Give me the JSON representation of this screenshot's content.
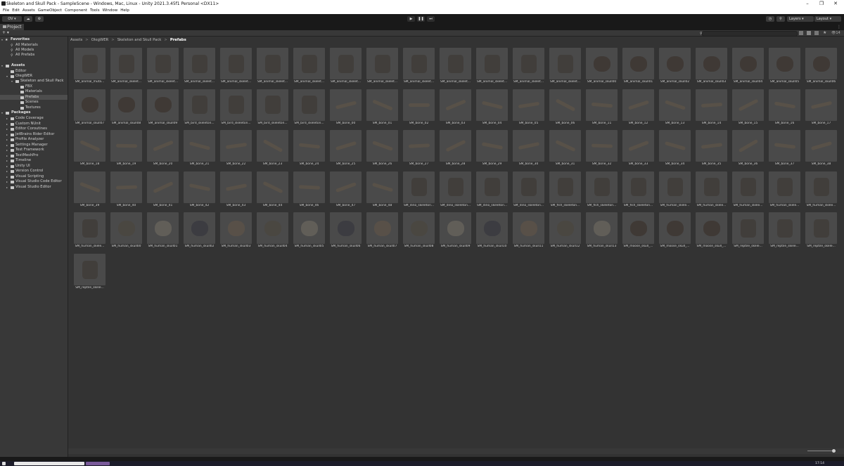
{
  "window": {
    "title": "Skeleton and Skull Pack - SampleScene - Windows, Mac, Linux - Unity 2021.3.45f1 Personal <DX11>"
  },
  "menu": [
    "File",
    "Edit",
    "Assets",
    "GameObject",
    "Component",
    "Tools",
    "Window",
    "Help"
  ],
  "toolbar": {
    "account": "OV",
    "layers": "Layers",
    "layout": "Layout"
  },
  "project_tab": "Project",
  "icon_count": "14",
  "sidebar": {
    "favorites_label": "Favorites",
    "favorites": [
      "All Materials",
      "All Models",
      "All Prefabs"
    ],
    "assets_label": "Assets",
    "assets": [
      "Editor",
      "OlegWER",
      "Skeleton and Skull Pack",
      "FBX",
      "Materials",
      "Prefabs",
      "Scenes",
      "Textures"
    ],
    "packages_label": "Packages",
    "packages": [
      "Code Coverage",
      "Custom NUnit",
      "Editor Coroutines",
      "JetBrains Rider Editor",
      "Profile Analyzer",
      "Settings Manager",
      "Test Framework",
      "TextMeshPro",
      "Timeline",
      "Unity UI",
      "Version Control",
      "Visual Scripting",
      "Visual Studio Code Editor",
      "Visual Studio Editor"
    ]
  },
  "breadcrumb": [
    "Assets",
    "OlegWER",
    "Skeleton and Skull Pack",
    "Prefabs"
  ],
  "assets": [
    "SM_animal_muta...",
    "SM_animal_skelet...",
    "SM_animal_skelet...",
    "SM_animal_skelet...",
    "SM_animal_skelet...",
    "SM_animal_skelet...",
    "SM_animal_skelet...",
    "SM_animal_skelet...",
    "SM_animal_skelet...",
    "SM_animal_skelet...",
    "SM_animal_skelet...",
    "SM_animal_skelet...",
    "SM_animal_skelet...",
    "SM_animal_skelet...",
    "SM_animal_skull00",
    "SM_animal_skull01",
    "SM_animal_skull02",
    "SM_animal_skull03",
    "SM_animal_skull04",
    "SM_animal_skull05",
    "SM_animal_skull06",
    "SM_animal_skull07",
    "SM_animal_skull08",
    "SM_animal_skull09",
    "SM_bird_skeleton...",
    "SM_bird_skeleton...",
    "SM_bird_skeleton...",
    "SM_bird_skeleton...",
    "SM_bone_00",
    "SM_bone_01",
    "SM_bone_02",
    "SM_bone_03",
    "SM_bone_04",
    "SM_bone_05",
    "SM_bone_06",
    "SM_bone_11",
    "SM_bone_12",
    "SM_bone_13",
    "SM_bone_14",
    "SM_bone_15",
    "SM_bone_16",
    "SM_bone_17",
    "SM_bone_18",
    "SM_bone_19",
    "SM_bone_20",
    "SM_bone_21",
    "SM_bone_22",
    "SM_bone_23",
    "SM_bone_24",
    "SM_bone_25",
    "SM_bone_26",
    "SM_bone_27",
    "SM_bone_28",
    "SM_bone_29",
    "SM_bone_30",
    "SM_bone_31",
    "SM_bone_32",
    "SM_bone_33",
    "SM_bone_34",
    "SM_bone_35",
    "SM_bone_36",
    "SM_bone_37",
    "SM_bone_38",
    "SM_bone_39",
    "SM_bone_40",
    "SM_bone_41",
    "SM_bone_42",
    "SM_bone_43",
    "SM_bone_44",
    "SM_bone_46",
    "SM_bone_47",
    "SM_bone_48",
    "SM_dino_skeleton...",
    "SM_dino_skeleton...",
    "SM_dino_skeleton...",
    "SM_dino_skeleton...",
    "SM_fish_skeleton...",
    "SM_fish_skeleton...",
    "SM_fish_skeleton...",
    "SM_human_skele...",
    "SM_human_skele...",
    "SM_human_skele...",
    "SM_human_skele...",
    "SM_human_skele...",
    "SM_human_skele...",
    "SM_human_skull00",
    "SM_human_skull01",
    "SM_human_skull02",
    "SM_human_skull03",
    "SM_human_skull04",
    "SM_human_skull05",
    "SM_human_skull06",
    "SM_human_skull07",
    "SM_human_skull08",
    "SM_human_skull09",
    "SM_human_skull10",
    "SM_human_skull11",
    "SM_human_skull12",
    "SM_human_skull13",
    "SM_moose_skull_...",
    "SM_moose_skull_...",
    "SM_moose_skull_...",
    "SM_reptile_skele...",
    "SM_reptile_skele...",
    "SM_reptile_skele...",
    "SM_reptile_skele..."
  ],
  "status": {
    "time": "17:14"
  },
  "colors": {
    "window_bg": "#282828",
    "panel_bg": "#383838",
    "grid_bg": "#333333",
    "tile_bg": "#4a4a4a",
    "selection": "#4d4d4d"
  }
}
